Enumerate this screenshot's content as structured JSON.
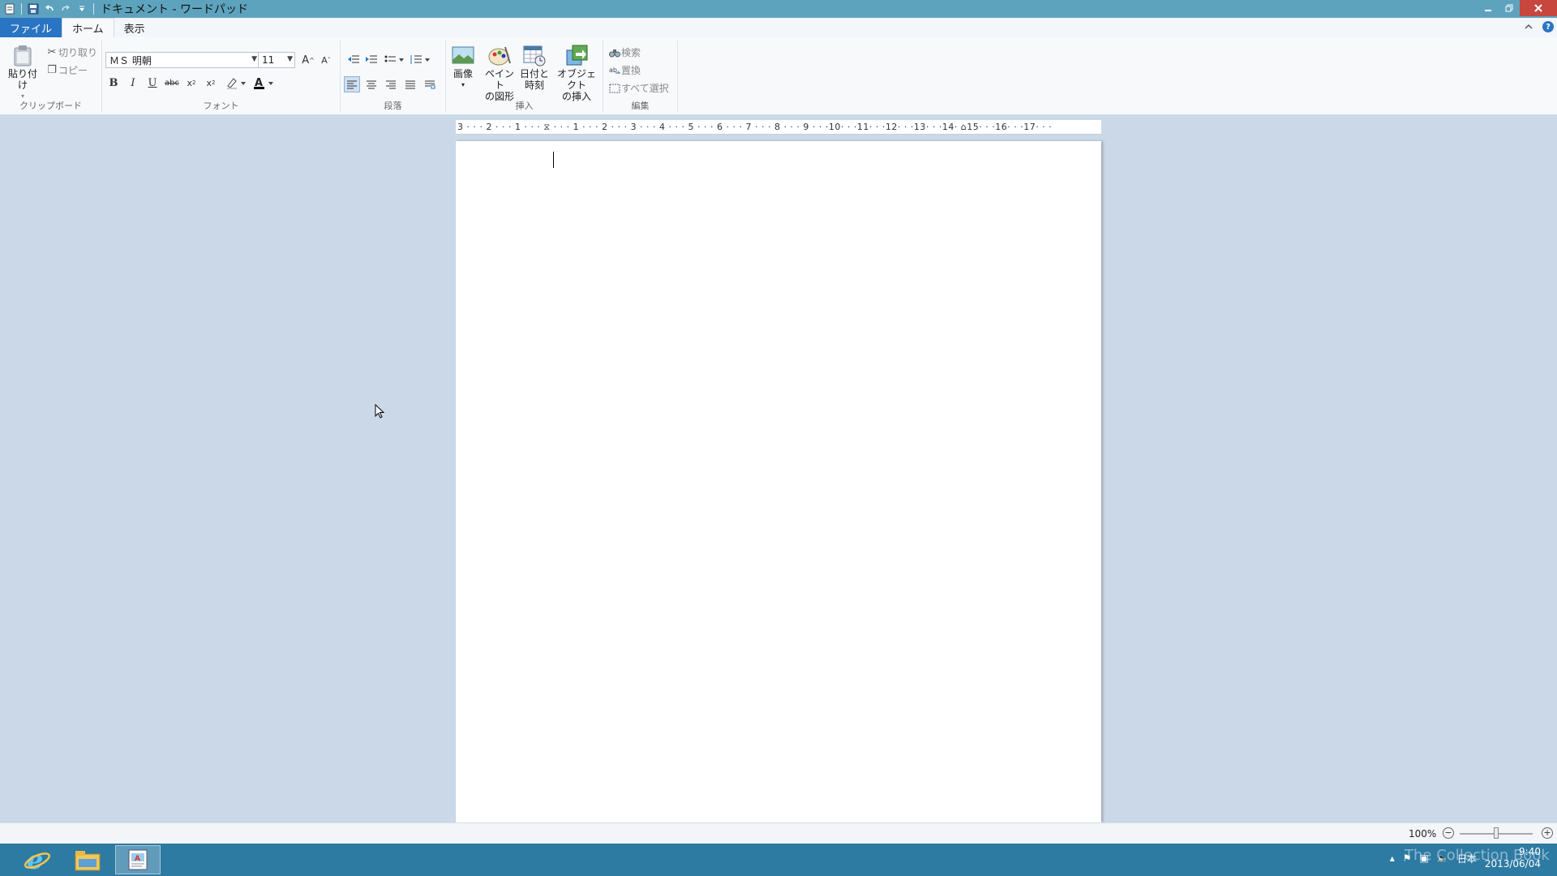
{
  "window": {
    "title": "ドキュメント - ワードパッド"
  },
  "tabs": [
    {
      "label": "ファイル"
    },
    {
      "label": "ホーム"
    },
    {
      "label": "表示"
    }
  ],
  "ribbon": {
    "clipboard": {
      "label": "クリップボード",
      "paste": "貼り付け",
      "cut": "切り取り",
      "copy": "コピー"
    },
    "font": {
      "label": "フォント",
      "family": "ＭＳ 明朝",
      "size": "11"
    },
    "paragraph": {
      "label": "段落"
    },
    "insert": {
      "label": "挿入",
      "picture": "画像",
      "paint_line1": "ペイント",
      "paint_line2": "の図形",
      "datetime_line1": "日付と",
      "datetime_line2": "時刻",
      "object_line1": "オブジェクト",
      "object_line2": "の挿入"
    },
    "editing": {
      "label": "編集",
      "find": "検索",
      "replace": "置換",
      "select_all": "すべて選択"
    }
  },
  "ruler": {
    "labels": "3 · · · 2 · · · 1 · · · ⧖ · · · 1 · · · 2 · · · 3 · · · 4 · · · 5 · · · 6 · · · 7 · · · 8 · · · 9 · · ·10· · ·11· · ·12· · ·13· · ·14· ⌂15· · ·16· · ·17· · ·"
  },
  "status": {
    "zoom": "100%"
  },
  "taskbar": {
    "tray_lang": "日本",
    "time": "9:40",
    "date": "2013/06/04"
  },
  "watermark": "The Collection Book",
  "colors": {
    "titlebar": "#5ea3bd",
    "file_tab": "#2a74c4",
    "close": "#c7463e",
    "taskbar": "#2d7aa3"
  }
}
